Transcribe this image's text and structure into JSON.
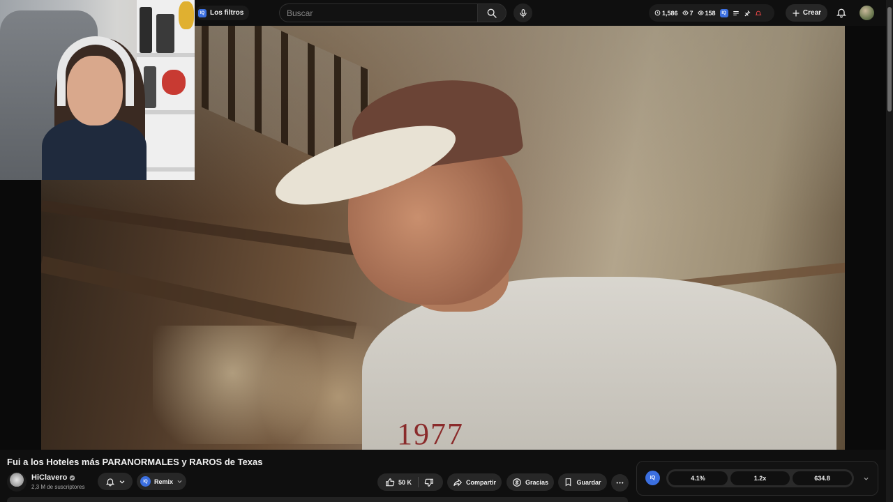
{
  "header": {
    "filters_label": "Los filtros",
    "search_placeholder": "Buscar",
    "stats": {
      "time": "1,586",
      "watching": "7",
      "views": "158"
    },
    "create_label": "Crear"
  },
  "video": {
    "title": "Fui a los Hoteles más PARANORMALES y RAROS de Texas",
    "shirt_text": "1977"
  },
  "channel": {
    "name": "HiClavero",
    "subscribers": "2,3 M de suscriptores",
    "verified": true
  },
  "actions": {
    "remix_label": "Remix",
    "like_count": "50 K",
    "share_label": "Compartir",
    "thanks_label": "Gracias",
    "save_label": "Guardar"
  },
  "extension": {
    "logo": "IQ",
    "metrics": [
      "4.1%",
      "1.2x",
      "634.8"
    ]
  },
  "colors": {
    "accent": "#3b6fe0",
    "background": "#0f0f0f",
    "pill": "#272727"
  },
  "icons": [
    "search-icon",
    "mic-icon",
    "bell-icon",
    "plus-icon",
    "like-icon",
    "dislike-icon",
    "share-icon",
    "thanks-icon",
    "save-icon",
    "more-icon",
    "chevron-down-icon"
  ]
}
